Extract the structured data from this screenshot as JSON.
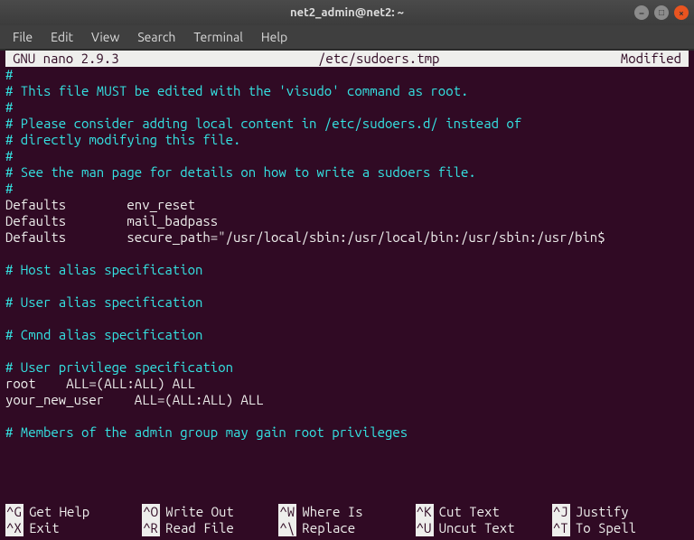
{
  "window": {
    "title": "net2_admin@net2: ~"
  },
  "menu": {
    "file": "File",
    "edit": "Edit",
    "view": "View",
    "search": "Search",
    "terminal": "Terminal",
    "help": "Help"
  },
  "nano": {
    "version": "GNU nano 2.9.3",
    "filepath": "/etc/sudoers.tmp",
    "status": "Modified"
  },
  "file_lines": [
    {
      "c": "comment",
      "t": "#"
    },
    {
      "c": "comment",
      "t": "# This file MUST be edited with the 'visudo' command as root."
    },
    {
      "c": "comment",
      "t": "#"
    },
    {
      "c": "comment",
      "t": "# Please consider adding local content in /etc/sudoers.d/ instead of"
    },
    {
      "c": "comment",
      "t": "# directly modifying this file."
    },
    {
      "c": "comment",
      "t": "#"
    },
    {
      "c": "comment",
      "t": "# See the man page for details on how to write a sudoers file."
    },
    {
      "c": "comment",
      "t": "#"
    },
    {
      "c": "text",
      "t": "Defaults        env_reset"
    },
    {
      "c": "text",
      "t": "Defaults        mail_badpass"
    },
    {
      "c": "text",
      "t": "Defaults        secure_path=\"/usr/local/sbin:/usr/local/bin:/usr/sbin:/usr/bin$"
    },
    {
      "c": "text",
      "t": ""
    },
    {
      "c": "comment",
      "t": "# Host alias specification"
    },
    {
      "c": "text",
      "t": ""
    },
    {
      "c": "comment",
      "t": "# User alias specification"
    },
    {
      "c": "text",
      "t": ""
    },
    {
      "c": "comment",
      "t": "# Cmnd alias specification"
    },
    {
      "c": "text",
      "t": ""
    },
    {
      "c": "comment",
      "t": "# User privilege specification"
    },
    {
      "c": "text",
      "t": "root    ALL=(ALL:ALL) ALL"
    },
    {
      "c": "text",
      "t": "your_new_user    ALL=(ALL:ALL) ALL"
    },
    {
      "c": "text",
      "t": ""
    },
    {
      "c": "comment",
      "t": "# Members of the admin group may gain root privileges"
    }
  ],
  "shortcuts": {
    "row1": [
      {
        "key": "^G",
        "label": "Get Help"
      },
      {
        "key": "^O",
        "label": "Write Out"
      },
      {
        "key": "^W",
        "label": "Where Is"
      },
      {
        "key": "^K",
        "label": "Cut Text"
      },
      {
        "key": "^J",
        "label": "Justify"
      }
    ],
    "row2": [
      {
        "key": "^X",
        "label": "Exit"
      },
      {
        "key": "^R",
        "label": "Read File"
      },
      {
        "key": "^\\",
        "label": "Replace"
      },
      {
        "key": "^U",
        "label": "Uncut Text"
      },
      {
        "key": "^T",
        "label": "To Spell"
      }
    ]
  }
}
